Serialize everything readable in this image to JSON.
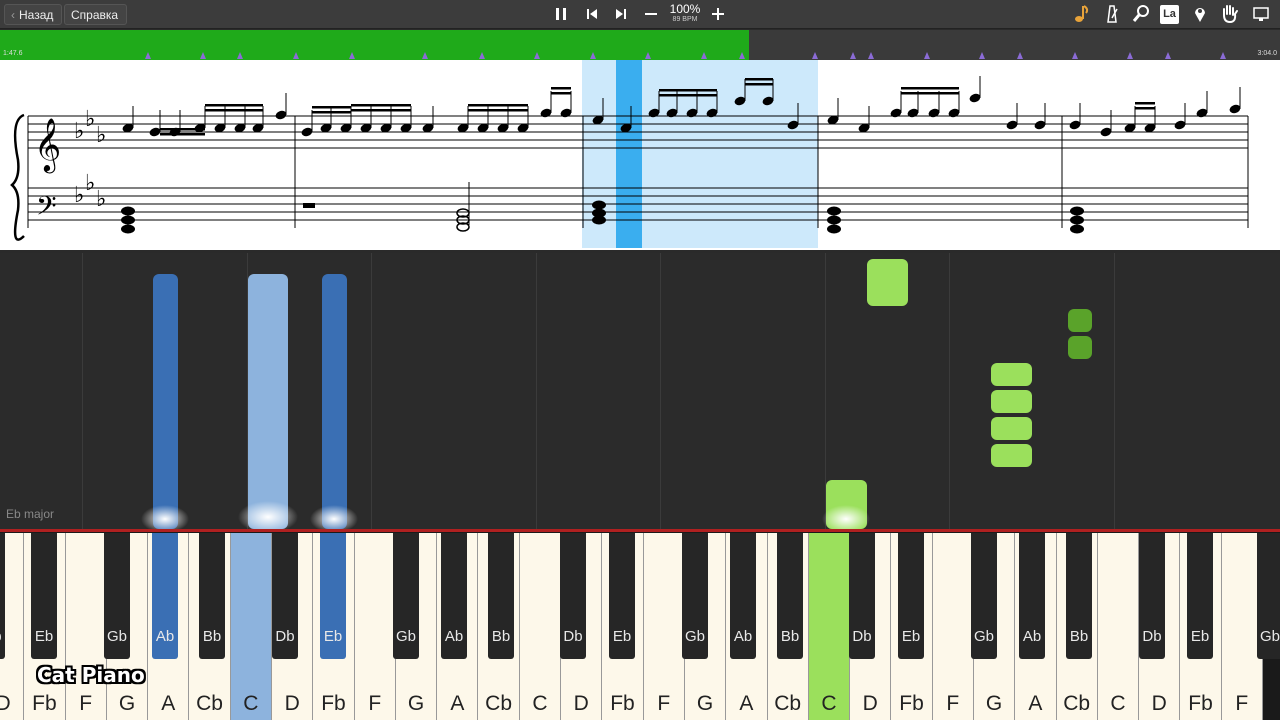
{
  "toolbar": {
    "back_label": "Назад",
    "help_label": "Справка",
    "tempo_percent": "100%",
    "tempo_bpm": "89 BPM",
    "label_icon_text": "La",
    "icons": [
      "pause-icon",
      "skip-back-icon",
      "skip-forward-icon",
      "minus-icon",
      "plus-icon",
      "note-icon",
      "metronome-icon",
      "magnifier-icon",
      "label-icon",
      "pin-icon",
      "hand-icon"
    ]
  },
  "progress": {
    "elapsed": "1:47.6",
    "total": "3:04.0",
    "fraction": 0.585,
    "fill_color": "#1faa1a"
  },
  "notes_area": {
    "key_signature": "Eb major"
  },
  "keyboard": {
    "white_keys": [
      "D",
      "Fb",
      "F",
      "G",
      "A",
      "Cb",
      "C",
      "D",
      "Fb",
      "F",
      "G",
      "A",
      "Cb",
      "C",
      "D",
      "Fb",
      "F",
      "G",
      "A",
      "Cb",
      "C",
      "D",
      "Fb",
      "F",
      "G",
      "A",
      "Cb",
      "C",
      "D",
      "Fb",
      "F"
    ],
    "black_keys": [
      "Db",
      "Eb",
      "Gb",
      "Ab",
      "Bb",
      "Db",
      "Eb",
      "Gb",
      "Ab",
      "Bb",
      "Db",
      "Eb",
      "Gb",
      "Ab",
      "Bb",
      "Db",
      "Eb",
      "Gb",
      "Ab",
      "Bb",
      "Db",
      "Eb",
      "Gb"
    ],
    "left_hand_color": "#3a6fb4",
    "right_hand_color": "#9be05c"
  },
  "watermark": "Cat Piano"
}
